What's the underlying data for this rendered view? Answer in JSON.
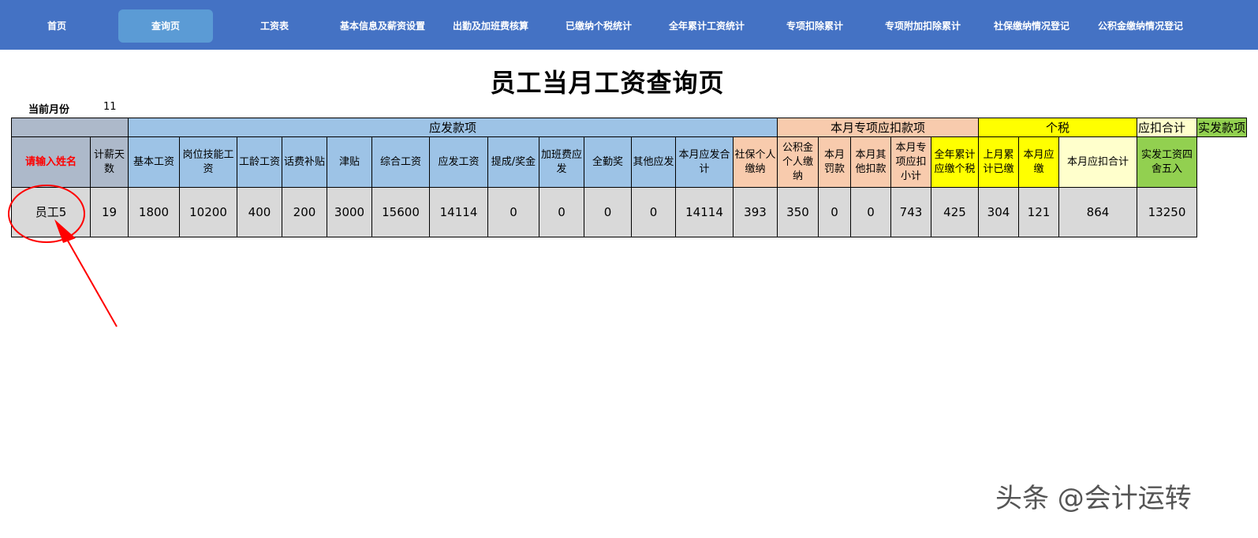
{
  "nav": {
    "items": [
      "首页",
      "查询页",
      "工资表",
      "基本信息及薪资设置",
      "出勤及加班费核算",
      "已缴纳个税统计",
      "全年累计工资统计",
      "专项扣除累计",
      "专项附加扣除累计",
      "社保缴纳情况登记",
      "公积金缴纳情况登记"
    ],
    "active_index": 1,
    "color": "#4472c4",
    "active_color": "#5b9bd5"
  },
  "page": {
    "title": "员工当月工资查询页",
    "month_label": "当前月份",
    "month_value": "11"
  },
  "table": {
    "groups": [
      "应发款项",
      "本月专项应扣款项",
      "个税",
      "应扣合计",
      "实发款项"
    ],
    "group_colors": {
      "name": "#adb9ca",
      "应发款项": "#9dc3e6",
      "本月专项应扣款项": "#f8cbad",
      "个税": "#ffff00",
      "应扣合计": "#ffffcc",
      "实发款项": "#92d050"
    },
    "name_prompt": "请输入姓名",
    "headers": [
      "计薪天数",
      "基本工资",
      "岗位技能工资",
      "工龄工资",
      "话费补贴",
      "津贴",
      "综合工资",
      "应发工资",
      "提成/奖金",
      "加班费应发",
      "全勤奖",
      "其他应发",
      "本月应发合计",
      "社保个人缴纳",
      "公积金个人缴纳",
      "本月罚款",
      "本月其他扣款",
      "本月专项应扣小计",
      "全年累计应缴个税",
      "上月累计已缴",
      "本月应缴",
      "本月应扣合计",
      "实发工资四舍五入"
    ],
    "employee_name": "员工5",
    "values": [
      "19",
      "1800",
      "10200",
      "400",
      "200",
      "3000",
      "15600",
      "14114",
      "0",
      "0",
      "0",
      "0",
      "14114",
      "393",
      "350",
      "0",
      "0",
      "743",
      "425",
      "304",
      "121",
      "864",
      "13250"
    ]
  },
  "annotation": {
    "color": "#ff0000",
    "shape": "ellipse-with-arrow",
    "target": "employee-name-cell"
  },
  "watermark": "头条 @会计运转"
}
